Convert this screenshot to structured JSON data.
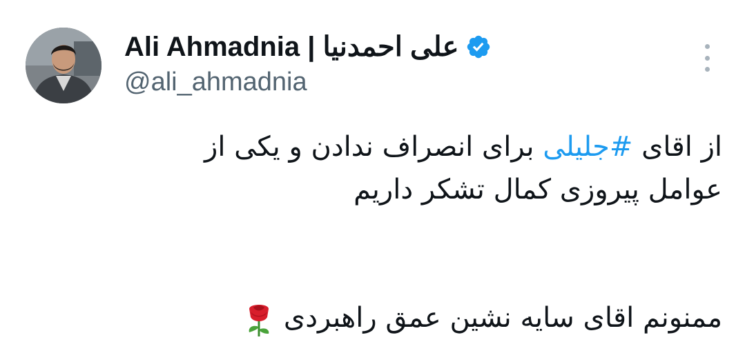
{
  "tweet": {
    "author": {
      "name": "Ali Ahmadnia | علی احمدنیا",
      "handle": "@ali_ahmadnia",
      "verified": true,
      "verified_color": "#1d9bf0",
      "avatar_icon": "profile-photo"
    },
    "more_icon": "more-options-icon",
    "body": {
      "line1_before": "از اقای ",
      "hashtag": "#جلیلی",
      "line1_after": " برای انصراف ندادن و یکی از",
      "line2": "عوامل پیروزی کمال تشکر داریم",
      "line3": "ممنونم اقای سایه نشین عمق راهبردی",
      "emoji": "rose-icon"
    },
    "colors": {
      "text": "#0f1419",
      "secondary": "#536471",
      "link": "#1d9bf0"
    }
  }
}
